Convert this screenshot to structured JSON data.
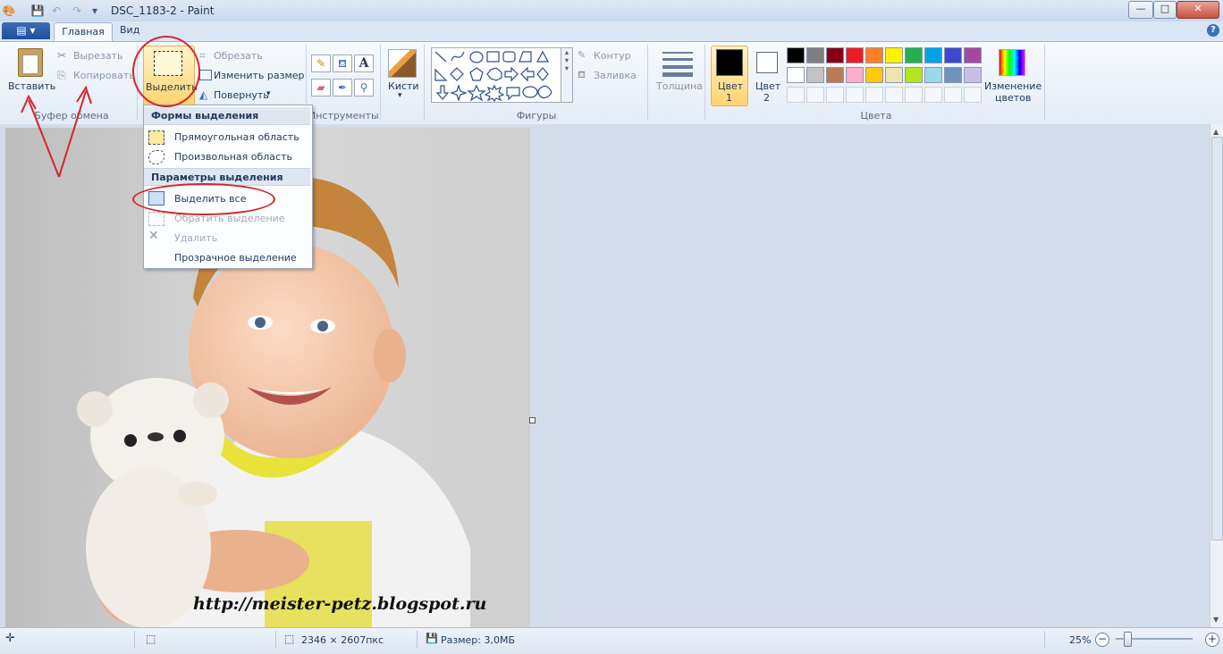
{
  "window": {
    "title": "DSC_1183-2 - Paint",
    "minimize_glyph": "—",
    "maximize_glyph": "□",
    "close_glyph": "✕"
  },
  "tabs": {
    "file": "▤ ▾",
    "home": "Главная",
    "view": "Вид",
    "help": "?"
  },
  "clipboard": {
    "paste": "Вставить",
    "cut": "Вырезать",
    "copy": "Копировать",
    "group": "Буфер обмена"
  },
  "image": {
    "select": "Выделить",
    "crop": "Обрезать",
    "resize": "Изменить размер",
    "rotate": "Повернуть"
  },
  "tools": {
    "group": "Инструменты"
  },
  "brushes": {
    "label": "Кисти"
  },
  "shapes": {
    "group": "Фигуры",
    "outline": "Контур",
    "fill": "Заливка"
  },
  "size": {
    "label": "Толщина"
  },
  "colors": {
    "group": "Цвета",
    "color1_line1": "Цвет",
    "color1_line2": "1",
    "color2_line1": "Цвет",
    "color2_line2": "2",
    "edit_line1": "Изменение",
    "edit_line2": "цветов",
    "color1": "#000000",
    "color2": "#ffffff",
    "palette_row1": [
      "#000000",
      "#7f7f7f",
      "#880015",
      "#ed1c24",
      "#ff7f27",
      "#fff200",
      "#22b14c",
      "#00a2e8",
      "#3f48cc",
      "#a349a4"
    ],
    "palette_row2": [
      "#ffffff",
      "#c3c3c3",
      "#b97a57",
      "#ffaec9",
      "#ffc90e",
      "#efe4b0",
      "#b5e61d",
      "#99d9ea",
      "#7092be",
      "#c8bfe7"
    ]
  },
  "select_menu": {
    "head1": "Формы выделения",
    "rect": "Прямоугольная область",
    "free": "Произвольная область",
    "head2": "Параметры выделения",
    "select_all": "Выделить все",
    "invert": "Обратить выделение",
    "delete": "Удалить",
    "transparent": "Прозрачное выделение"
  },
  "canvas": {
    "watermark": "http://meister-petz.blogspot.ru"
  },
  "status": {
    "dimensions": "2346 × 2607пкс",
    "size": "Размер: 3,0МБ",
    "zoom": "25%"
  }
}
